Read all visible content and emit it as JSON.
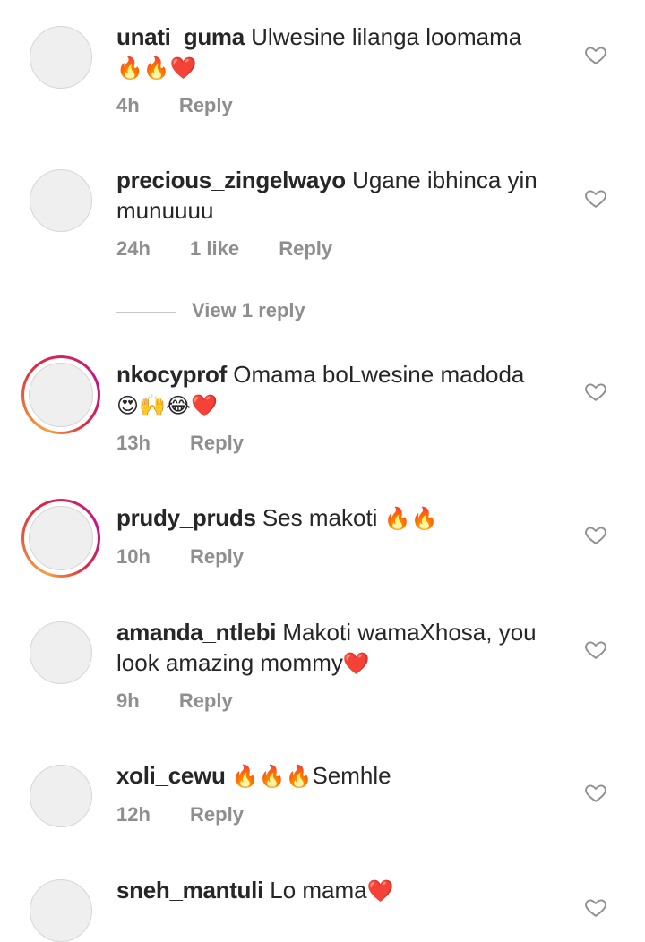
{
  "comments": [
    {
      "username": "unati_guma",
      "text": "Ulwesine lilanga loomama",
      "emoji": "🔥🔥❤️",
      "time": "4h",
      "likes": "",
      "reply": "Reply"
    },
    {
      "username": "precious_zingelwayo",
      "text": "Ugane ibhinca yin munuuuu",
      "emoji": "",
      "time": "24h",
      "likes": "1 like",
      "reply": "Reply"
    },
    {
      "username": "nkocyprof",
      "text": "Omama boLwesine madoda",
      "emoji": "😍🙌😂❤️",
      "time": "13h",
      "likes": "",
      "reply": "Reply"
    },
    {
      "username": "prudy_pruds",
      "text": "Ses makoti",
      "emoji": "🔥🔥",
      "time": "10h",
      "likes": "",
      "reply": "Reply"
    },
    {
      "username": "amanda_ntlebi",
      "text": "Makoti wamaXhosa, you look amazing mommy",
      "emoji": "❤️",
      "time": "9h",
      "likes": "",
      "reply": "Reply"
    },
    {
      "username": "xoli_cewu",
      "text": "Semhle",
      "emoji": "🔥🔥🔥",
      "time": "12h",
      "likes": "",
      "reply": "Reply"
    },
    {
      "username": "sneh_mantuli",
      "text": "Lo mama",
      "emoji": "❤️",
      "time": "",
      "likes": "",
      "reply": ""
    }
  ],
  "view_replies": "View 1 reply",
  "icons": {
    "like": "heart-outline-icon"
  },
  "colors": {
    "meta": "#8e8e8e",
    "text": "#262626",
    "heart": "#e0245e"
  }
}
